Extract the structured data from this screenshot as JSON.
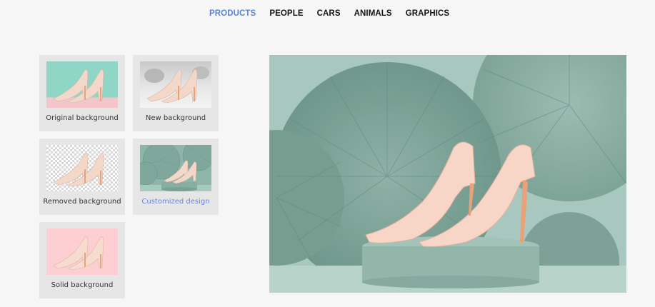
{
  "nav": {
    "items": [
      "PRODUCTS",
      "PEOPLE",
      "CARS",
      "ANIMALS",
      "GRAPHICS"
    ],
    "active": "PRODUCTS"
  },
  "thumbnails": [
    {
      "caption": "Original background"
    },
    {
      "caption": "New background"
    },
    {
      "caption": "Removed background"
    },
    {
      "caption": "Customized design"
    },
    {
      "caption": "Solid background"
    }
  ],
  "colors": {
    "accent": "#5b86d6",
    "teal": "#9fc4ba",
    "pink": "#fdcfd3",
    "shoe": "#f4d4c6"
  }
}
